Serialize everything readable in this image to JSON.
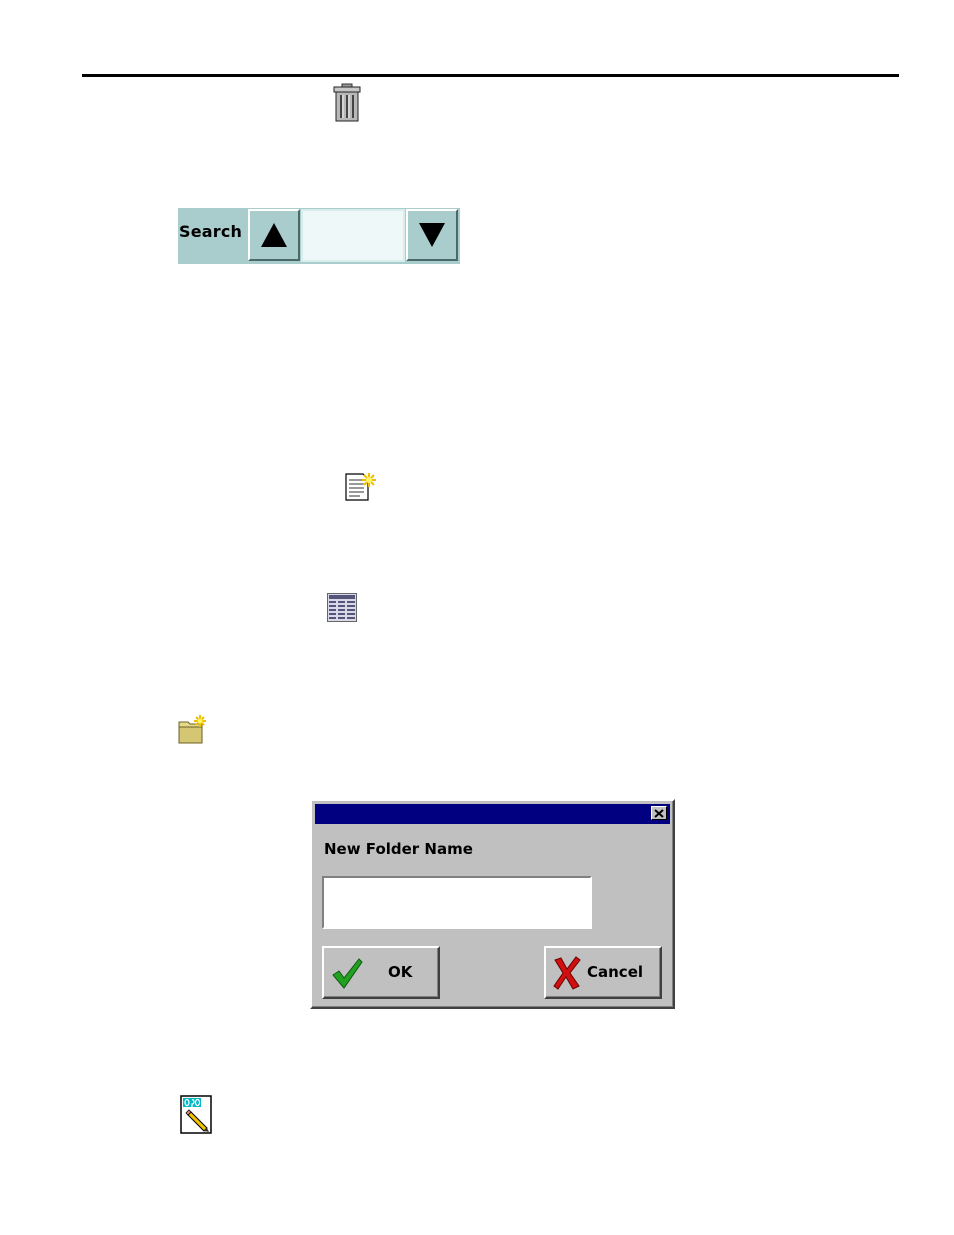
{
  "search": {
    "label": "Search",
    "input_value": ""
  },
  "icons": {
    "trash": "trash-can-icon",
    "new_document": "new-document-icon",
    "table_view": "table-view-icon",
    "new_folder": "new-folder-icon",
    "note": "note-pencil-icon"
  },
  "dialog": {
    "title": "",
    "label": "New Folder Name",
    "input_value": "",
    "ok_label": "OK",
    "cancel_label": "Cancel"
  },
  "colors": {
    "search_bg": "#a9cccc",
    "titlebar": "#000080",
    "dialog_bg": "#c0c0c0",
    "ok_check": "#22a022",
    "cancel_x": "#d01010"
  }
}
